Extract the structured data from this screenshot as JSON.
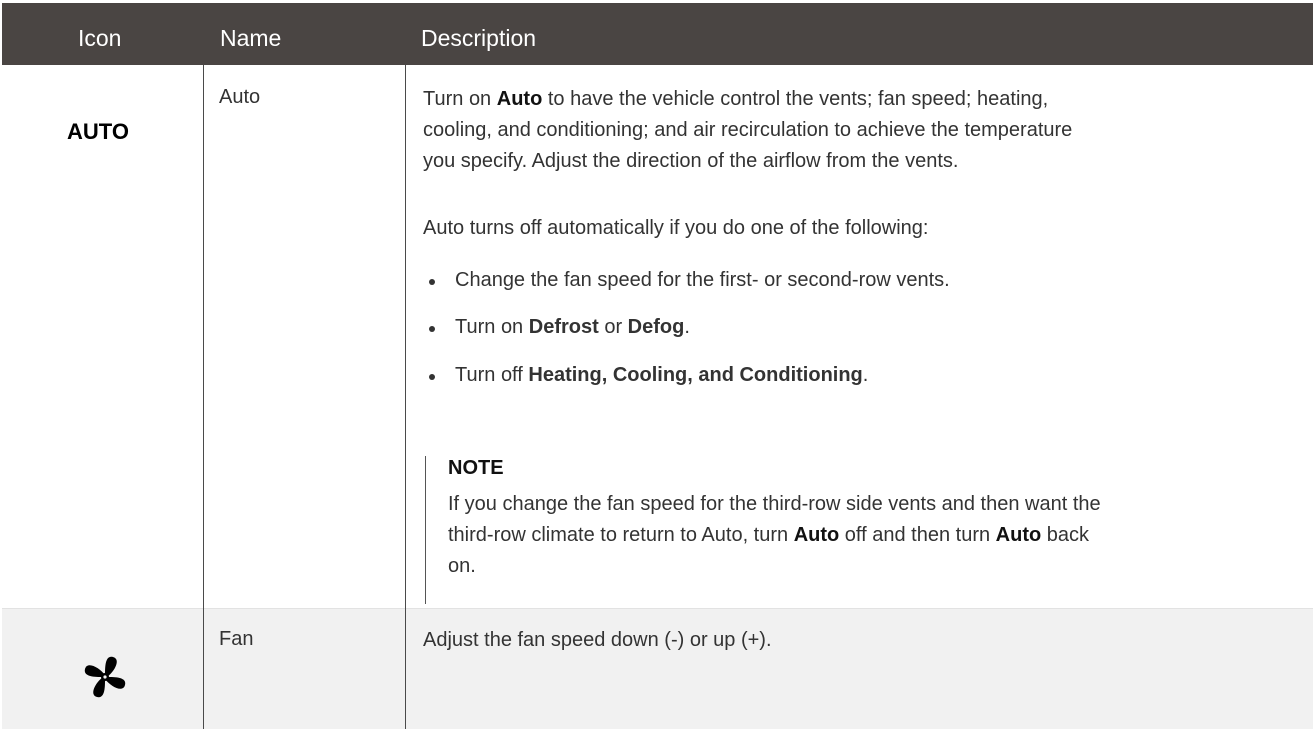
{
  "table": {
    "headers": {
      "icon": "Icon",
      "name": "Name",
      "description": "Description"
    },
    "rows": [
      {
        "icon_text": "AUTO",
        "name": "Auto",
        "description": {
          "para1": [
            "Turn on ",
            "Auto",
            " to have the vehicle control the vents; fan speed; heating,",
            "cooling, and conditioning; and air recirculation to achieve the temperature",
            "you specify. Adjust the direction of the airflow from the vents."
          ],
          "para2": "Auto turns off automatically if you do one of the following:",
          "bullets": [
            {
              "parts": [
                "Change the fan speed for the first- or second-row vents."
              ]
            },
            {
              "parts": [
                "Turn on ",
                "Defrost",
                " or ",
                "Defog",
                "."
              ]
            },
            {
              "parts": [
                "Turn off ",
                "Heating, Cooling, and Conditioning",
                "."
              ]
            }
          ],
          "note": {
            "title": "NOTE",
            "text": [
              "If you change the fan speed for the third-row side vents and then want the",
              "third-row climate to return to Auto, turn ",
              "Auto",
              " off and then turn ",
              "Auto",
              " back",
              "on."
            ]
          }
        }
      },
      {
        "icon": "fan-icon",
        "name": "Fan",
        "description": "Adjust the fan speed down (-) or up (+)."
      }
    ]
  },
  "colors": {
    "header_bg": "#4a4543",
    "header_text": "#ffffff",
    "row_alt_bg": "#f1f1f1",
    "body_text": "#333333"
  }
}
